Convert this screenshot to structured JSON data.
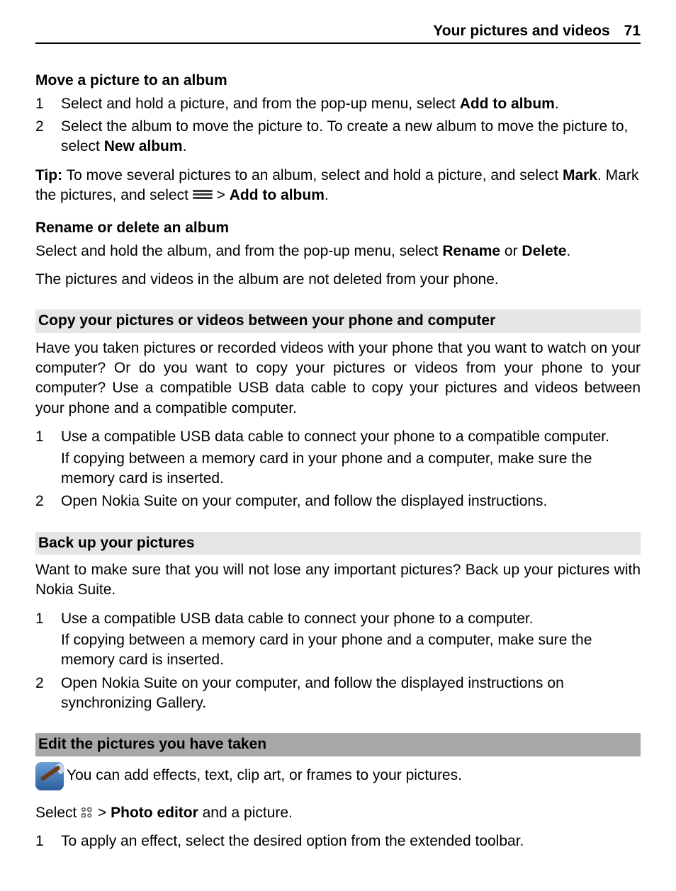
{
  "header": {
    "section": "Your pictures and videos",
    "page": "71"
  },
  "s1": {
    "title": "Move a picture to an album",
    "step1_a": "Select and hold a picture, and from the pop-up menu, select ",
    "step1_b": "Add to album",
    "step1_c": ".",
    "step2_a": "Select the album to move the picture to. To create a new album to move the picture to, select ",
    "step2_b": "New album",
    "step2_c": ".",
    "tip_label": "Tip:",
    "tip_a": " To move several pictures to an album, select and hold a picture, and select ",
    "tip_b": "Mark",
    "tip_c": ". Mark the pictures, and select ",
    "tip_d": " > ",
    "tip_e": "Add to album",
    "tip_f": "."
  },
  "s2": {
    "title": "Rename or delete an album",
    "p1_a": "Select and hold the album, and from the pop-up menu, select ",
    "p1_b": "Rename",
    "p1_c": " or ",
    "p1_d": "Delete",
    "p1_e": ".",
    "p2": "The pictures and videos in the album are not deleted from your phone."
  },
  "s3": {
    "title": "Copy your pictures or videos between your phone and computer",
    "intro": "Have you taken pictures or recorded videos with your phone that you want to watch on your computer? Or do you want to copy your pictures or videos from your phone to your computer? Use a compatible USB data cable to copy your pictures and videos between your phone and a compatible computer.",
    "step1": "Use a compatible USB data cable to connect your phone to a compatible computer.",
    "step1_sub": "If copying between a memory card in your phone and a computer, make sure the memory card is inserted.",
    "step2": "Open Nokia Suite on your computer, and follow the displayed instructions."
  },
  "s4": {
    "title": "Back up your pictures",
    "intro": "Want to make sure that you will not lose any important pictures? Back up your pictures with Nokia Suite.",
    "step1": "Use a compatible USB data cable to connect your phone to a computer.",
    "step1_sub": "If copying between a memory card in your phone and a computer, make sure the memory card is inserted.",
    "step2": "Open Nokia Suite on your computer, and follow the displayed instructions on synchronizing Gallery."
  },
  "s5": {
    "title": "Edit the pictures you have taken",
    "intro": " You can add effects, text, clip art, or frames to your pictures.",
    "sel_a": "Select ",
    "sel_b": " > ",
    "sel_c": "Photo editor",
    "sel_d": " and a picture.",
    "step1": "To apply an effect, select the desired option from the extended toolbar."
  },
  "nums": {
    "n1": "1",
    "n2": "2"
  }
}
